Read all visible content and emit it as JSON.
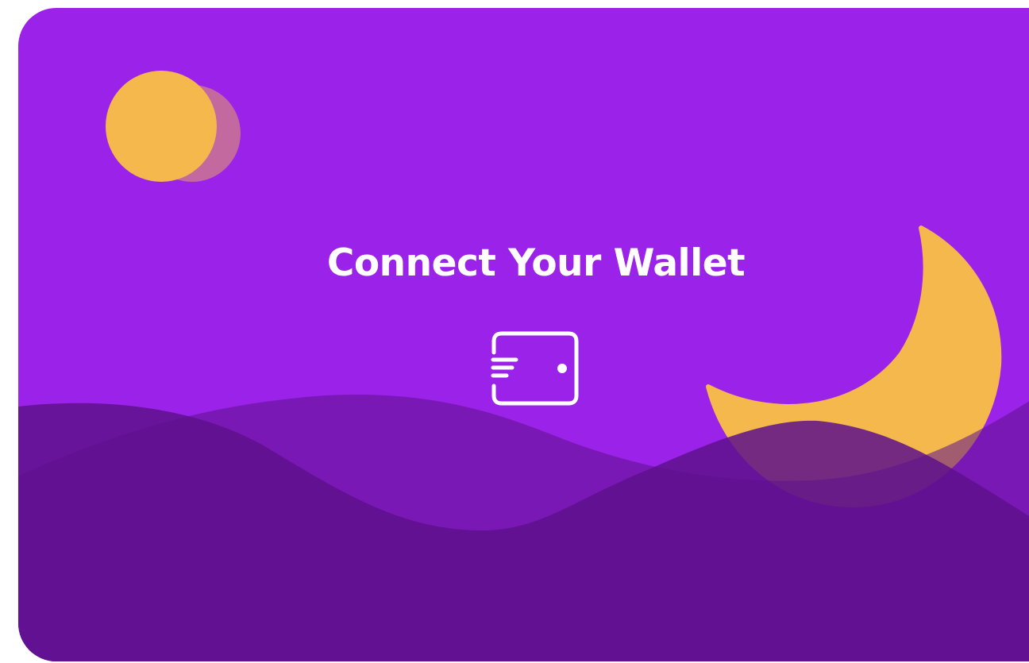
{
  "hero": {
    "title": "Connect Your Wallet"
  },
  "icons": {
    "wallet": "wallet-icon",
    "sun": "sun-shape",
    "moon": "crescent-moon-shape"
  },
  "colors": {
    "background": "#9b22e8",
    "sun": "#f4b84d",
    "moon": "#f4b84d",
    "hill_dark": "#66128f",
    "hill_mid": "#7c1cb5",
    "text": "#ffffff"
  }
}
